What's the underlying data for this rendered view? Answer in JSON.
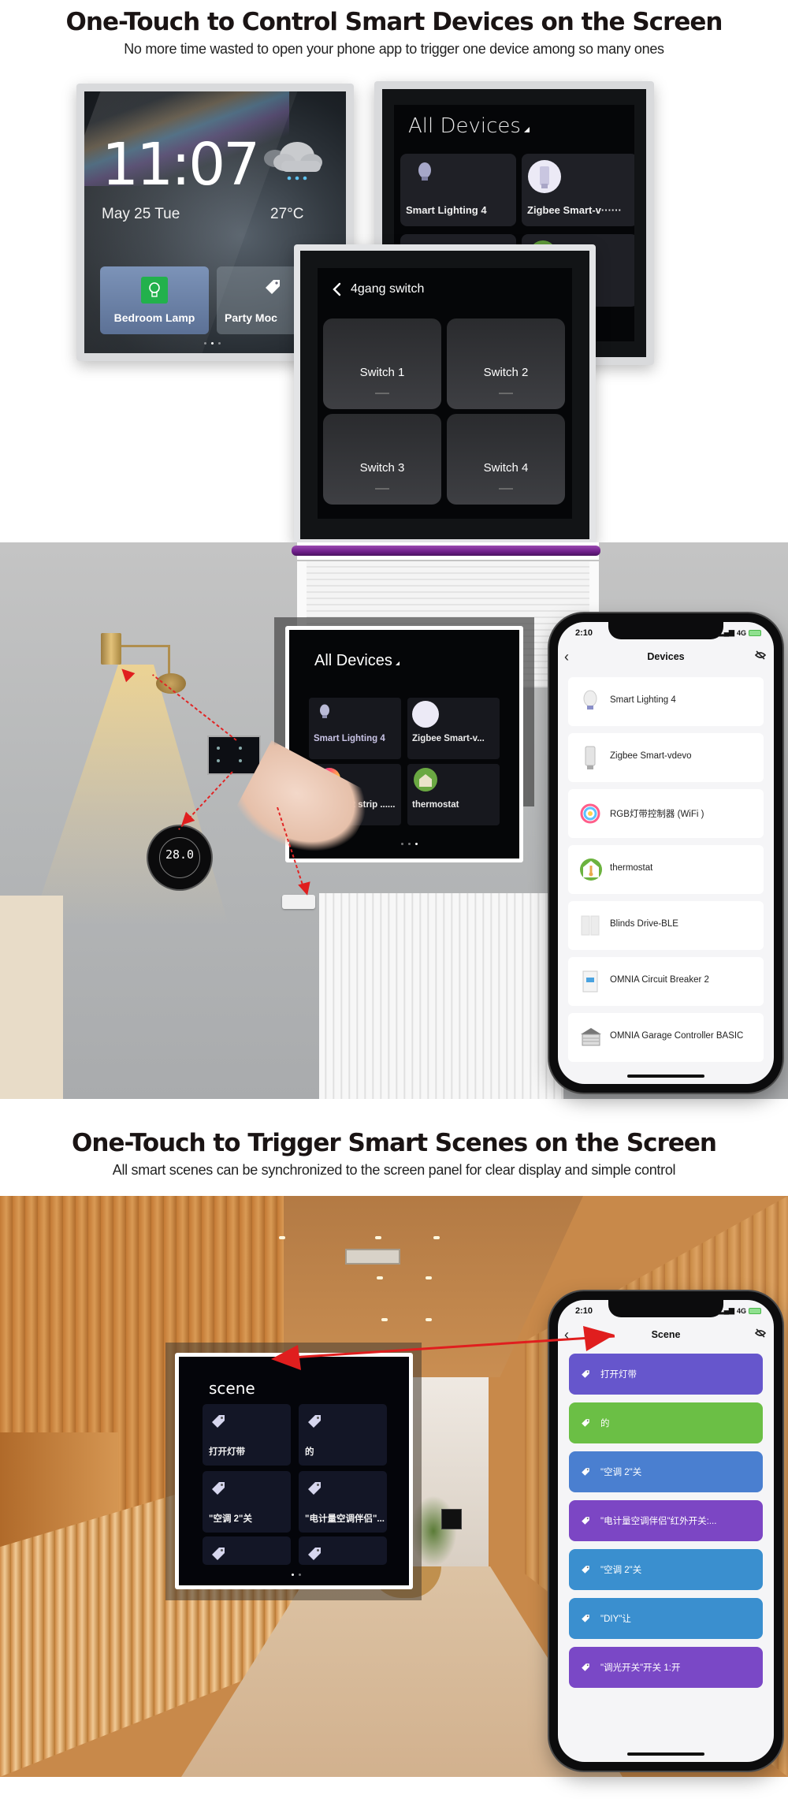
{
  "section1": {
    "title": "One-Touch to Control Smart Devices on the Screen",
    "subtitle": "No more time wasted to open your phone app to trigger one device among so many ones"
  },
  "home_panel": {
    "time": "11:07",
    "date": "May 25 Tue",
    "temperature": "27°C",
    "weather_icon": "cloud-rain-icon",
    "tiles": [
      {
        "label": "Bedroom Lamp",
        "icon": "lightbulb-icon",
        "icon_bg": "#22b14c"
      },
      {
        "label": "Party Moc",
        "icon": "tag-icon"
      }
    ],
    "page_dots": 3,
    "active_dot": 2
  },
  "devices_panel_top": {
    "title": "All Devices",
    "cards": [
      {
        "label": "Smart Lighting 4",
        "icon": "lightbulb-icon"
      },
      {
        "label": "Zigbee Smart-v······",
        "icon": "valve-icon"
      }
    ]
  },
  "gang_panel": {
    "back_icon": "chevron-left-icon",
    "title": "4gang switch",
    "switches": [
      "Switch 1",
      "Switch 2",
      "Switch 3",
      "Switch 4"
    ]
  },
  "devices_panel_mid": {
    "title": "All Devices",
    "cards": [
      {
        "label": "Smart Lighting 4",
        "icon": "lightbulb-icon"
      },
      {
        "label": "Zigbee Smart-v...",
        "icon": "valve-icon"
      },
      {
        "label": "RGB light strip ......",
        "icon": "rgb-ring-icon"
      },
      {
        "label": "thermostat",
        "icon": "thermometer-house-icon"
      }
    ],
    "page_dots": 3,
    "active_dot": 3
  },
  "thermostat_device": {
    "display": "28.0"
  },
  "phone_devices": {
    "status_time": "2:10",
    "network": "4G",
    "title": "Devices",
    "back_icon": "chevron-left-icon",
    "right_icon": "eye-off-icon",
    "rows": [
      {
        "label": "Smart Lighting 4",
        "icon": "lightbulb-icon"
      },
      {
        "label": "Zigbee Smart-vdevo",
        "icon": "valve-icon"
      },
      {
        "label": "RGB灯带控制器 (WiFi )",
        "icon": "rgb-ring-icon"
      },
      {
        "label": "thermostat",
        "icon": "thermometer-house-icon"
      },
      {
        "label": "Blinds Drive-BLE",
        "icon": "blinds-icon"
      },
      {
        "label": "OMNIA Circuit Breaker 2",
        "icon": "breaker-icon"
      },
      {
        "label": "OMNIA Garage Controller BASIC",
        "icon": "garage-icon"
      }
    ]
  },
  "section2": {
    "title": "One-Touch to Trigger Smart Scenes on the Screen",
    "subtitle": "All smart scenes can be synchronized to the screen panel for clear display and simple control"
  },
  "scene_panel": {
    "title": "scene",
    "cards": [
      {
        "label": "打开灯带"
      },
      {
        "label": "的"
      },
      {
        "label": "\"空调 2\"关"
      },
      {
        "label": "\"电计量空调伴侣\"..."
      },
      {
        "label": ""
      },
      {
        "label": ""
      }
    ]
  },
  "phone_scene": {
    "status_time": "2:10",
    "network": "4G",
    "title": "Scene",
    "back_icon": "chevron-left-icon",
    "right_icon": "eye-off-icon",
    "rows": [
      {
        "label": "打开灯带",
        "color": "#6656cc"
      },
      {
        "label": "的",
        "color": "#6bbf45"
      },
      {
        "label": "\"空调 2\"关",
        "color": "#4a7fd0"
      },
      {
        "label": "\"电计量空调伴侣\"红外开关:...",
        "color": "#7c46c4"
      },
      {
        "label": "\"空调 2\"关",
        "color": "#3a8fcf"
      },
      {
        "label": "\"DIY\"让",
        "color": "#3a8fcf"
      },
      {
        "label": "\"调光开关\"开关 1:开",
        "color": "#7a48c6"
      }
    ]
  },
  "colors": {
    "arrow_red": "#e01e1e",
    "panel_bg": "#050608"
  }
}
